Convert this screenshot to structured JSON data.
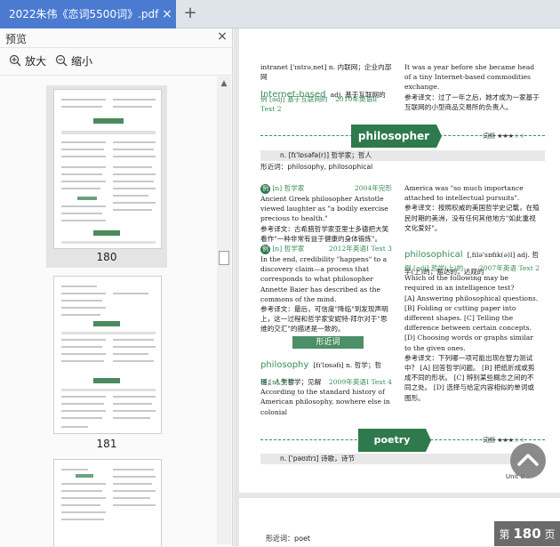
{
  "tab": {
    "title": "2022朱伟《恋词5500词》.pdf",
    "close": "×",
    "add": "+"
  },
  "sidebar": {
    "title": "预览",
    "close": "×",
    "zoom_in": "放大",
    "zoom_out": "缩小",
    "thumbnails": [
      {
        "page": "180",
        "label": "philosopher"
      },
      {
        "page": "181",
        "label": "balance"
      },
      {
        "page": "182",
        "label": ""
      }
    ]
  },
  "document": {
    "intranet_line": "intranet ['ɪntrəˌnet] n. 内联网；企业内部网",
    "internet_based": "Internet-based",
    "internet_based_def": "adj. 基于互联网的",
    "ex1_prefix": "例 [adj] 基于互联网的",
    "ex1_source": "2010年英语Ⅱ Text 2",
    "right_top_en": "It was a year before she became head of a tiny Internet-based commodities exchange.",
    "right_top_cn": "参考译文：过了一年之后，她才成为一家基于互联网的小型商品交易所的负责人。",
    "band1_word": "philosopher",
    "band1_freq": "词频 ★★★☆☆",
    "pos1": "n. [fɪ'lɒsəfə(r)] 哲学家；哲人",
    "deriv1": "形近词：philosophy, philosophical",
    "ex2_tag": "[n] 哲学家",
    "ex2_source": "2004年完形",
    "ex2_en": "Ancient Greek philosopher Aristotle viewed laughter as \"a bodily exercise precious to health.\"",
    "ex2_cn": "参考译文：古希腊哲学家亚里士多德把大笑看作\"一种非常有益于健康的身体锻炼\"。",
    "ex3_tag": "[n] 哲学家",
    "ex3_source": "2012年英语I Text 3",
    "ex3_en": "In the end, credibility \"happens\" to a discovery claim—a process that corresponds to what philosopher Annette Baier has described as the commons of the mind.",
    "ex3_cn": "参考译文：最后，可信度\"降临\"到发现声明上，这一过程和哲学家安妮特·拜尔对于\"思维的交汇\"的描述是一致的。",
    "similar_label": "形近词",
    "philosophy_word": "philosophy",
    "philosophy_def": "[fɪ'lɒsəfɪ] n. 哲学；哲理；人生哲学；见解",
    "ex4_tag": "例 [n] 哲学",
    "ex4_source": "2009年英语I Text 4",
    "ex4_en": "According to the standard history of American philosophy, nowhere else in colonial",
    "right_mid_en": "America was \"so much importance attached to intellectual pursuits\".",
    "right_mid_cn": "参考译文：按照权威的美国哲学史记载，在殖民时期的美洲，没有任何其他地方\"如此重视文化爱好\"。",
    "philosophical_word": "philosophical",
    "philosophical_def": "[ˌfɪlə'sɒfɪk(ə)l] adj. 哲学(上)的；豁达的，达观的",
    "ex5_tag": "例 [adj] 哲学(上)的",
    "ex5_source": "2007年英语 Text 2",
    "ex5_en": "Which of the following may be required in an intelligence test?",
    "ex5_options": "[A] Answering philosophical questions. [B] Folding or cutting paper into different shapes. [C] Telling the difference between certain concepts. [D] Choosing words or graphs similar to the given ones.",
    "ex5_cn": "参考译文：下列哪一项可能出现在智力测试中？ [A] 回答哲学问题。 [B] 把纸折成或剪成不同的形状。 [C] 辨别某些概念之间的不同之处。 [D] 选择与给定内容相似的单词或图形。",
    "band2_word": "poetry",
    "band2_freq": "词频 ★★★☆☆",
    "pos2": "n. ['pəʊɪtrɪ] 诗歌，诗节",
    "unit_label": "Unit 8",
    "page2_deriv": "形近词：poet"
  },
  "page_indicator": {
    "prefix": "第",
    "number": "180",
    "suffix": "页"
  }
}
